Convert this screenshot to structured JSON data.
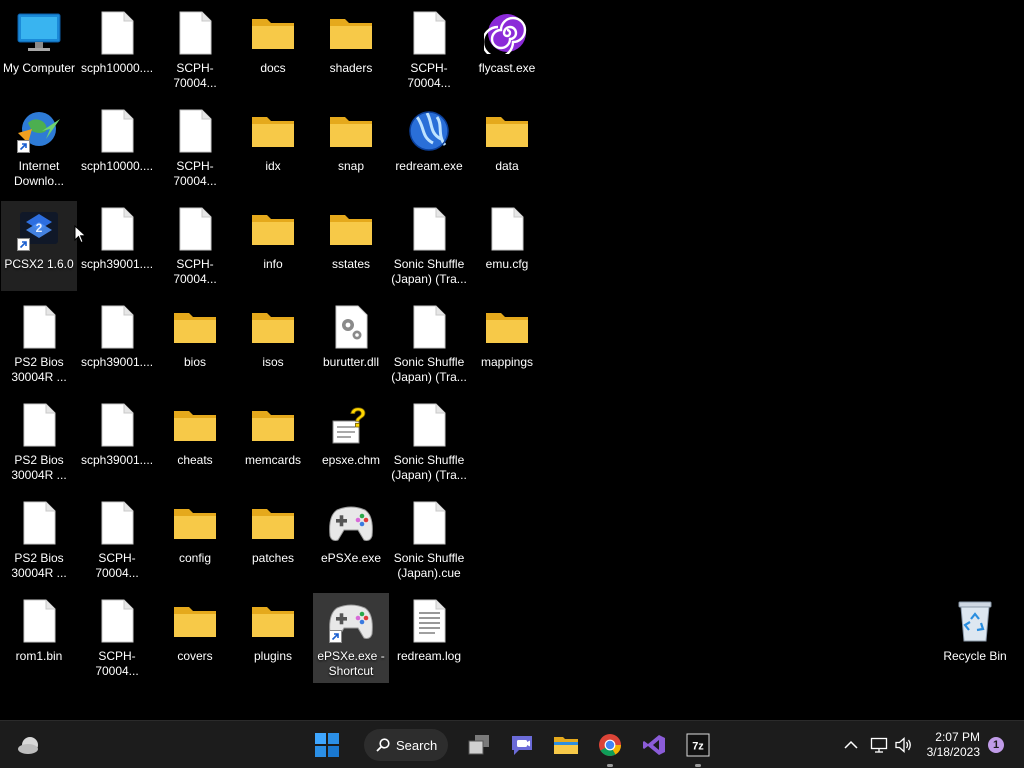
{
  "desktop": {
    "icons": [
      {
        "label": "My Computer"
      },
      {
        "label": "scph10000...."
      },
      {
        "label": "SCPH-70004..."
      },
      {
        "label": "docs"
      },
      {
        "label": "shaders"
      },
      {
        "label": "SCPH-70004..."
      },
      {
        "label": "flycast.exe"
      },
      {
        "label": "Internet\nDownlo..."
      },
      {
        "label": "scph10000...."
      },
      {
        "label": "SCPH-70004..."
      },
      {
        "label": "idx"
      },
      {
        "label": "snap"
      },
      {
        "label": "redream.exe"
      },
      {
        "label": "data"
      },
      {
        "label": "PCSX2 1.6.0"
      },
      {
        "label": "scph39001...."
      },
      {
        "label": "SCPH-70004..."
      },
      {
        "label": "info"
      },
      {
        "label": "sstates"
      },
      {
        "label": "Sonic Shuffle\n(Japan) (Tra..."
      },
      {
        "label": "emu.cfg"
      },
      {
        "label": "PS2 Bios\n30004R ..."
      },
      {
        "label": "scph39001...."
      },
      {
        "label": "bios"
      },
      {
        "label": "isos"
      },
      {
        "label": "burutter.dll"
      },
      {
        "label": "Sonic Shuffle\n(Japan) (Tra..."
      },
      {
        "label": "mappings"
      },
      {
        "label": "PS2 Bios\n30004R ..."
      },
      {
        "label": "scph39001...."
      },
      {
        "label": "cheats"
      },
      {
        "label": "memcards"
      },
      {
        "label": "epsxe.chm"
      },
      {
        "label": "Sonic Shuffle\n(Japan) (Tra..."
      },
      {
        "label": "PS2 Bios\n30004R ..."
      },
      {
        "label": "SCPH-70004..."
      },
      {
        "label": "config"
      },
      {
        "label": "patches"
      },
      {
        "label": "ePSXe.exe"
      },
      {
        "label": "Sonic Shuffle\n(Japan).cue"
      },
      {
        "label": "rom1.bin"
      },
      {
        "label": "SCPH-70004..."
      },
      {
        "label": "covers"
      },
      {
        "label": "plugins"
      },
      {
        "label": "ePSXe.exe -\nShortcut"
      },
      {
        "label": "redream.log"
      },
      {
        "label": "Recycle Bin"
      }
    ]
  },
  "taskbar": {
    "search_label": "Search",
    "time": "2:07 PM",
    "date": "3/18/2023",
    "notification_count": "1"
  },
  "colors": {
    "folder": "#f7c948",
    "accent_blue": "#0078d4",
    "taskbar_bg": "#1c1c1c"
  }
}
